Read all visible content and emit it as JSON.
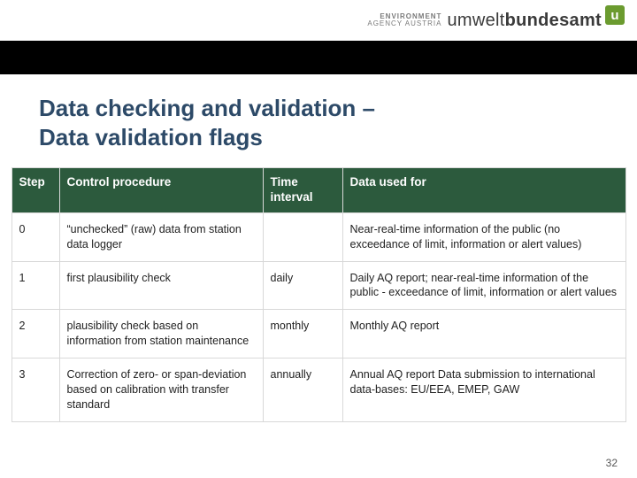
{
  "brand": {
    "sub_line1": "ENVIRONMENT",
    "sub_line2": "AGENCY AUSTRIA",
    "word_part1": "umwelt",
    "word_part2": "bundesamt",
    "badge": "u"
  },
  "title": {
    "line1": "Data checking and validation –",
    "line2": "Data validation flags"
  },
  "table": {
    "headers": {
      "step": "Step",
      "procedure": "Control procedure",
      "time_l1": "Time",
      "time_l2": "interval",
      "used_for": "Data used for"
    },
    "rows": [
      {
        "step": "0",
        "procedure": "“unchecked” (raw) data from station data logger",
        "time": "",
        "used": "Near-real-time information of the public (no exceedance of limit, information or alert values)"
      },
      {
        "step": "1",
        "procedure": "first plausibility check",
        "time": "daily",
        "used": "Daily AQ report;\nnear-real-time information of the public - exceedance of limit, information or alert values"
      },
      {
        "step": "2",
        "procedure": "plausibility check based on information from station maintenance",
        "time": "monthly",
        "used": "Monthly AQ report"
      },
      {
        "step": "3",
        "procedure": "Correction of zero- or span-deviation based on calibration with transfer standard",
        "time": "annually",
        "used": "Annual AQ report\nData submission to international data-bases: EU/EEA, EMEP, GAW"
      }
    ]
  },
  "page_number": "32"
}
